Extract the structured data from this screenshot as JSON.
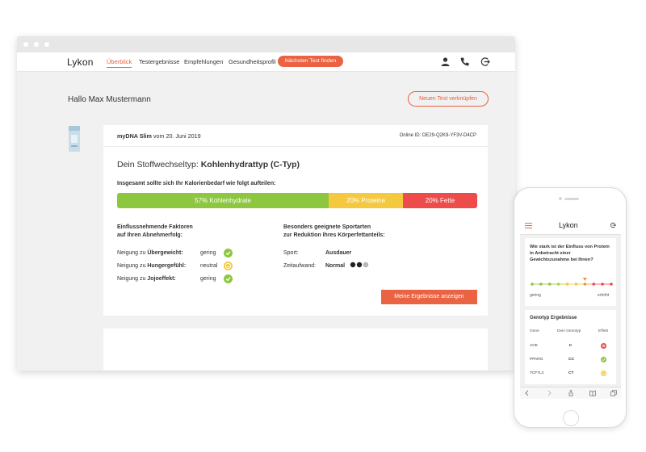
{
  "nav": {
    "logo": "Lykon",
    "items": [
      "Überblick",
      "Testergebnisse",
      "Empfehlungen",
      "Gesundheitsprofil"
    ],
    "cta": "Nächsten Test finden"
  },
  "page": {
    "greeting": "Hallo Max Mustermann",
    "link_button": "Neuen Test verknüpfen"
  },
  "test_card": {
    "product": "myDNA Slim",
    "date_text": "vom 20. Juni 2019",
    "online_id": "Online ID: DE29-Q2K9-YF3V-D4CP",
    "type_prefix": "Dein Stoffwechseltyp:",
    "type_value": "Kohlenhydrattyp (C-Typ)",
    "kcal_text": "Insgesamt sollte sich Ihr Kalorienbedarf wie folgt aufteilen:",
    "macros": [
      {
        "label": "57% Kohlenhydrate",
        "percent": 57,
        "color": "#8dc63f"
      },
      {
        "label": "20% Proteine",
        "percent": 20,
        "color": "#f5c93e"
      },
      {
        "label": "20% Fette",
        "percent": 20,
        "color": "#ee4b4b"
      }
    ],
    "factors_heading_1": "Einflussnehmende Faktoren",
    "factors_heading_2": "auf Ihren Abnehmerfolg:",
    "factors": [
      {
        "prefix": "Neigung zu",
        "name": "Übergewicht:",
        "value": "gering",
        "status": "good"
      },
      {
        "prefix": "Neigung zu",
        "name": "Hungergefühl:",
        "value": "neutral",
        "status": "neutral"
      },
      {
        "prefix": "Neigung zu",
        "name": "Jojoeffekt:",
        "value": "gering",
        "status": "good"
      }
    ],
    "sport_heading_1": "Besonders geeignete Sportarten",
    "sport_heading_2": "zur Reduktion Ihres Körperfettanteils:",
    "sport_label": "Sport:",
    "sport_value": "Ausdauer",
    "effort_label": "Zeitaufwand:",
    "effort_value": "Normal",
    "effort_level": 2,
    "effort_max": 3,
    "results_button": "Meine Ergebnisse anzeigen"
  },
  "mobile": {
    "logo": "Lykon",
    "question": "Wie stark ist der Einfluss von Protein in Anbetracht einer Gewichtszunahme bei Ihnen?",
    "scale_low": "gering",
    "scale_high": "erhöht",
    "scale_marker_index": 6,
    "scale_points": 10,
    "genotype_heading": "Genotyp Ergebnisse",
    "table_headers": [
      "Gene",
      "Dein Genotyp",
      "Effekt"
    ],
    "rows": [
      {
        "gene": "ACE",
        "genotype": "II",
        "effect": "bad"
      },
      {
        "gene": "PPARG",
        "genotype": "CC",
        "effect": "good"
      },
      {
        "gene": "TCF7L2",
        "genotype": "CT",
        "effect": "neutral"
      }
    ]
  },
  "colors": {
    "accent": "#ea6342",
    "good": "#8dc63f",
    "neutral": "#f5c93e",
    "bad": "#ee4b4b"
  }
}
